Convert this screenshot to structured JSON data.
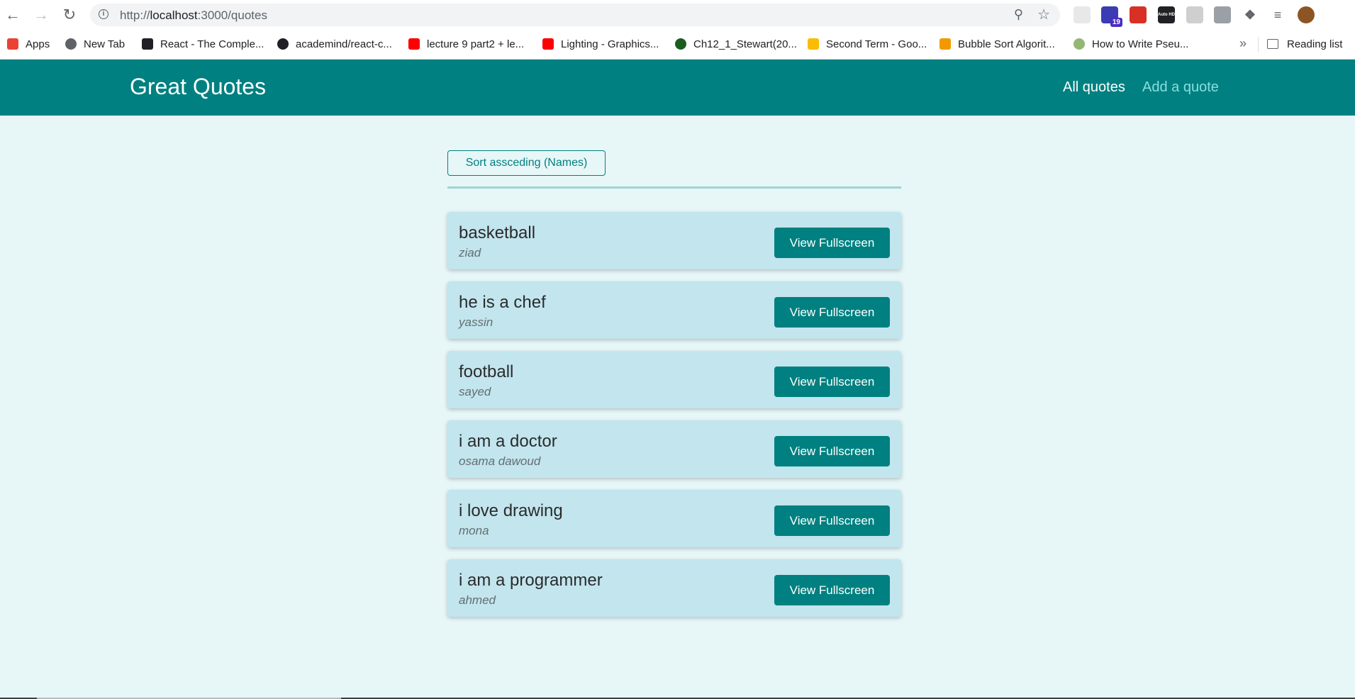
{
  "browser": {
    "url_prefix": "http://",
    "url_host": "localhost",
    "url_path": ":3000/quotes",
    "extensions": [
      {
        "icon": "calendar-ext-icon",
        "color": "#e8e8e8"
      },
      {
        "icon": "graduation-cap-ext-icon",
        "color": "#3b3bb3",
        "badge": "19"
      },
      {
        "icon": "red-ext-icon",
        "color": "#d93025"
      },
      {
        "icon": "auto-hd-ext-icon",
        "color": "#202124",
        "label": "Auto HD"
      },
      {
        "icon": "circle-ext-icon",
        "color": "#cfcfcf"
      },
      {
        "icon": "camera-ext-icon",
        "color": "#9aa0a6"
      },
      {
        "icon": "puzzle-icon",
        "color": "#5f6368"
      },
      {
        "icon": "media-list-icon",
        "color": "#5f6368"
      },
      {
        "icon": "profile-avatar",
        "color": "#8d5524"
      }
    ],
    "bookmarks": [
      {
        "label": "Apps",
        "icon": "apps-grid-icon",
        "color": "#ea4335"
      },
      {
        "label": "New Tab",
        "icon": "globe-icon",
        "color": "#5f6368"
      },
      {
        "label": "React - The Comple...",
        "icon": "download-icon",
        "color": "#202124"
      },
      {
        "label": "academind/react-c...",
        "icon": "github-icon",
        "color": "#202124"
      },
      {
        "label": "lecture 9 part2 + le...",
        "icon": "youtube-icon",
        "color": "#ff0000"
      },
      {
        "label": "Lighting - Graphics...",
        "icon": "youtube-icon",
        "color": "#ff0000"
      },
      {
        "label": "Ch12_1_Stewart(20...",
        "icon": "university-seal-icon",
        "color": "#1b5e20"
      },
      {
        "label": "Second Term - Goo...",
        "icon": "google-drive-icon",
        "color": "#fbbc04"
      },
      {
        "label": "Bubble Sort Algorit...",
        "icon": "orange-site-icon",
        "color": "#f29900"
      },
      {
        "label": "How to Write Pseu...",
        "icon": "wikihow-icon",
        "color": "#93b874"
      }
    ],
    "reading_list": "Reading list"
  },
  "header": {
    "logo": "Great Quotes",
    "nav_all": "All quotes",
    "nav_add": "Add a quote"
  },
  "sort_button": "Sort assceding (Names)",
  "view_label": "View Fullscreen",
  "quotes": [
    {
      "text": "basketball",
      "author": "ziad"
    },
    {
      "text": "he is a chef",
      "author": "yassin"
    },
    {
      "text": "football",
      "author": "sayed"
    },
    {
      "text": "i am a doctor",
      "author": "osama dawoud"
    },
    {
      "text": "i love drawing",
      "author": "mona"
    },
    {
      "text": "i am a programmer",
      "author": "ahmed"
    }
  ]
}
